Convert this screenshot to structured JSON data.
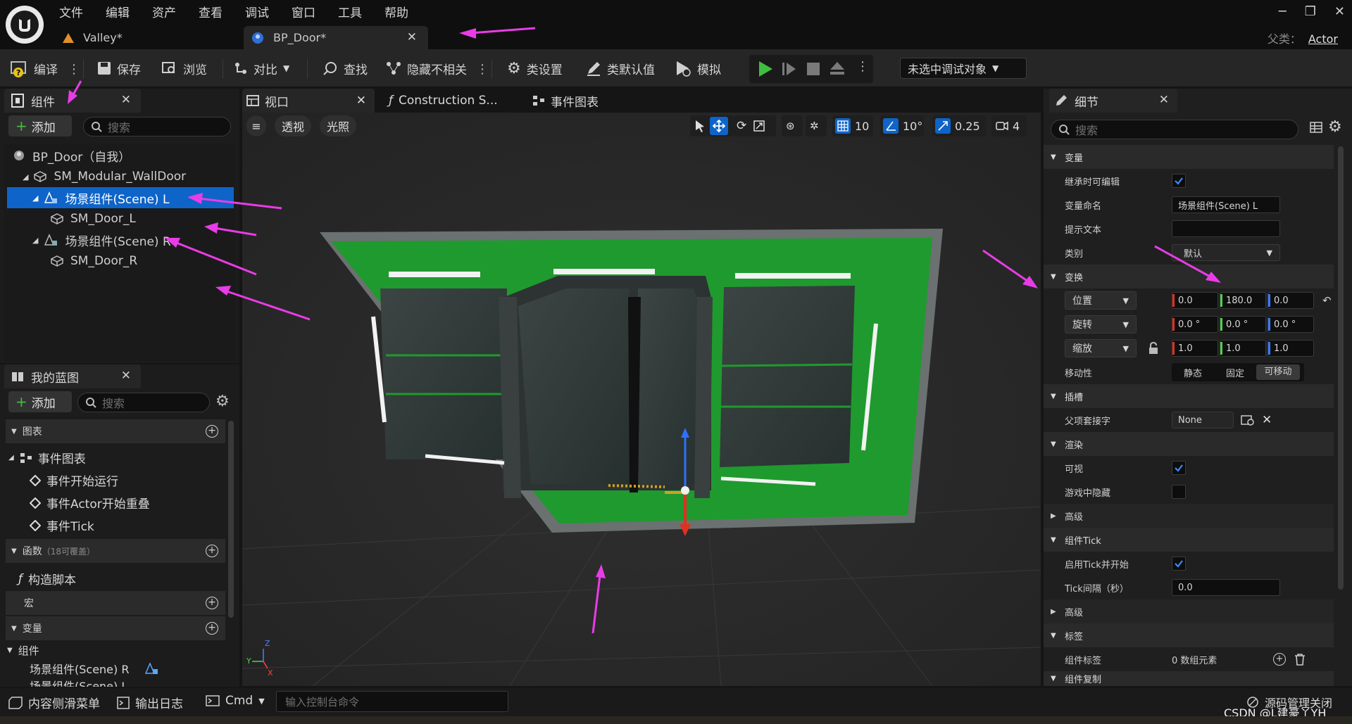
{
  "menu": [
    "文件",
    "编辑",
    "资产",
    "查看",
    "调试",
    "窗口",
    "工具",
    "帮助"
  ],
  "tabs": [
    {
      "label": "Valley*"
    },
    {
      "label": "BP_Door*"
    }
  ],
  "parent": {
    "label": "父类：",
    "value": "Actor"
  },
  "window_controls": {
    "minimize": "─",
    "restore": "❐",
    "close": "✕"
  },
  "toolbar": {
    "compile": "编译",
    "save": "保存",
    "browse": "浏览",
    "diff": "对比",
    "find": "查找",
    "hide_unrelated": "隐藏不相关",
    "class_settings": "类设置",
    "class_defaults": "类默认值",
    "simulate": "模拟",
    "debug_target": "未选中调试对象"
  },
  "components": {
    "tab": "组件",
    "add": "添加",
    "search_placeholder": "搜索",
    "tree": [
      "BP_Door（自我）",
      "SM_Modular_WallDoor",
      "场景组件(Scene) L",
      "SM_Door_L",
      "场景组件(Scene) R",
      "SM_Door_R"
    ]
  },
  "my_blueprint": {
    "tab": "我的蓝图",
    "add": "添加",
    "search_placeholder": "搜索",
    "graphs": "图表",
    "event_graph": "事件图表",
    "events": [
      "事件开始运行",
      "事件Actor开始重叠",
      "事件Tick"
    ],
    "functions": "函数",
    "functions_note": "（18可覆盖）",
    "construction": "构造脚本",
    "macros": "宏",
    "variables": "变量",
    "components_group": "组件",
    "component_vars": [
      "场景组件(Scene) R",
      "场景组件(Scene) L"
    ]
  },
  "viewport": {
    "tabs": [
      "视口",
      "Construction S...",
      "事件图表"
    ],
    "perspective": "透视",
    "lighting": "光照",
    "grid": "10",
    "angle": "10°",
    "scale": "0.25",
    "camera": "4"
  },
  "details": {
    "tab": "细节",
    "search_placeholder": "搜索",
    "variable_section": "变量",
    "editable": "继承时可编辑",
    "var_name_label": "变量命名",
    "var_name": "场景组件(Scene) L",
    "tooltip_label": "提示文本",
    "category_label": "类别",
    "category": "默认",
    "transform_section": "变换",
    "location": "位置",
    "location_values": [
      "0.0",
      "180.0",
      "0.0"
    ],
    "rotation": "旋转",
    "rotation_values": [
      "0.0 °",
      "0.0 °",
      "0.0 °"
    ],
    "scale": "缩放",
    "scale_values": [
      "1.0",
      "1.0",
      "1.0"
    ],
    "mobility": "移动性",
    "mobility_options": [
      "静态",
      "固定",
      "可移动"
    ],
    "sockets_section": "插槽",
    "parent_socket": "父项套接字",
    "socket_value": "None",
    "rendering_section": "渲染",
    "visible": "可视",
    "hidden_in_game": "游戏中隐藏",
    "advanced": "高级",
    "tick_section": "组件Tick",
    "tick_start": "启用Tick并开始",
    "tick_interval": "Tick间隔（秒）",
    "tick_interval_value": "0.0",
    "advanced2": "高级",
    "tags_section": "标签",
    "component_tags": "组件标签",
    "tags_value": "0 数组元素",
    "replication_section": "组件复制"
  },
  "bottom": {
    "content_drawer": "内容侧滑菜单",
    "output_log": "输出日志",
    "cmd": "Cmd",
    "cmd_placeholder": "输入控制台命令",
    "source_control": "源码管理关闭",
    "watermark": "CSDN @L建豪丫YH"
  },
  "colors": {
    "selection": "#0e64c8",
    "annotation_arrow": "#e83ce6",
    "door_green": "#1f9a2e",
    "play_green": "#3fbf3f"
  }
}
